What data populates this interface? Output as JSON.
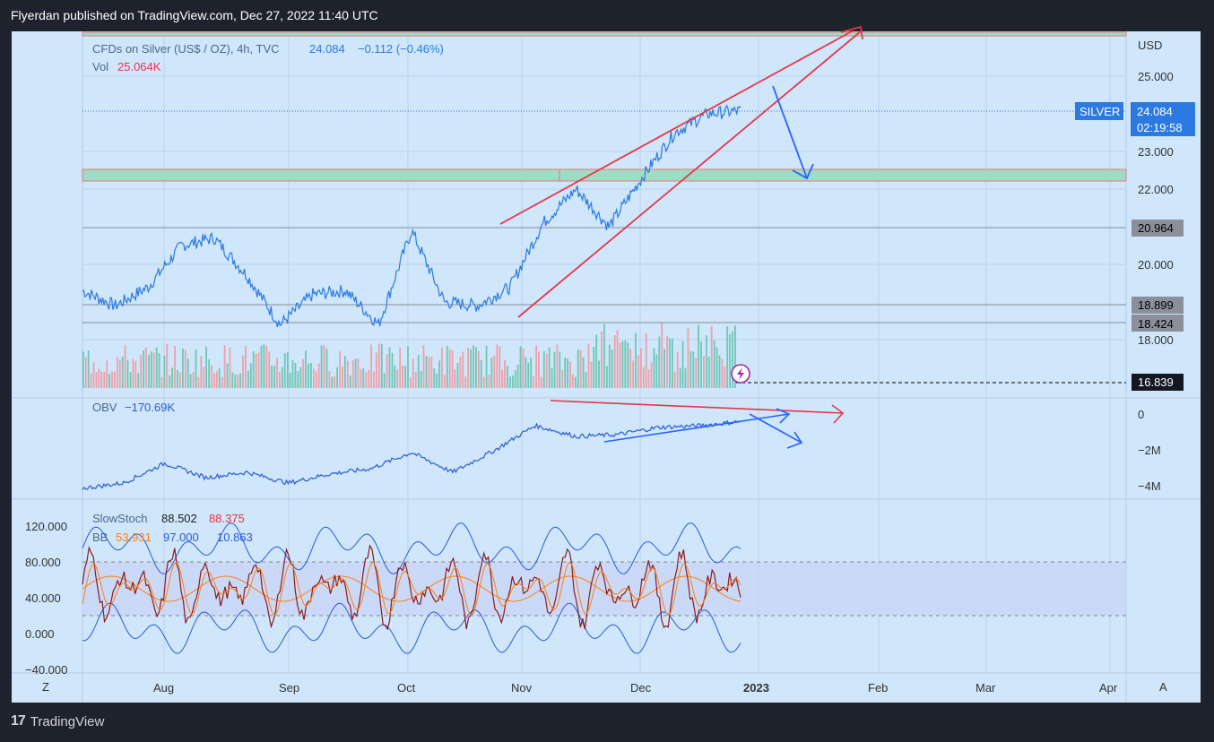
{
  "header": {
    "publisher": "Flyerdan published on TradingView.com, Dec 27, 2022 11:40 UTC"
  },
  "footer": {
    "logo_mark": "17",
    "logo_text": "TradingView"
  },
  "colors": {
    "price_line": "#2a7ae2",
    "up_volume": "#6fc7b4",
    "down_volume": "#f0a0a8",
    "trend_red": "#e8364a",
    "arrow_blue": "#2962ff",
    "stoch_k": "#8b1a1a",
    "stoch_d": "#ff7f0e",
    "bb": "#2a5bd7",
    "zone": "#9fdcc6",
    "band_fill": "#c8d6f7"
  },
  "main_legend": {
    "symbol": "CFDs on Silver (US$ / OZ), 4h, TVC",
    "price": "24.084",
    "change": "−0.112 (−0.46%)",
    "vol_label": "Vol",
    "vol_value": "25.064K"
  },
  "price_axis": {
    "unit": "USD",
    "ticks": [
      "25.000",
      "23.000",
      "22.000",
      "20.000",
      "18.000"
    ],
    "silver_badge": "SILVER",
    "last_price": "24.084",
    "countdown": "02:19:58",
    "level_labels": [
      "20.964",
      "18.899",
      "18.424",
      "16.839"
    ]
  },
  "obv": {
    "label": "OBV",
    "value": "−170.69K",
    "ticks": [
      "0",
      "−2M",
      "−4M"
    ]
  },
  "stoch": {
    "label": "SlowStoch",
    "k": "88.502",
    "d": "88.375",
    "bb_label": "BB",
    "bb_basis": "53.931",
    "bb_upper": "97.000",
    "bb_lower": "10.863",
    "ticks": [
      "120.000",
      "80.000",
      "40.000",
      "0.000",
      "−40.000"
    ]
  },
  "time_axis": {
    "labels": [
      "Aug",
      "Sep",
      "Oct",
      "Nov",
      "Dec",
      "2023",
      "Feb",
      "Mar",
      "Apr"
    ],
    "z_button": "Z",
    "a_button": "A"
  },
  "chart_data": {
    "type": "line",
    "title": "CFDs on Silver (US$ / OZ), 4h, TVC",
    "ylabel": "USD",
    "ylim": [
      16.839,
      25.6
    ],
    "x_range": [
      "Jul",
      "Apr"
    ],
    "x": [
      "Jul",
      "Aug",
      "Aug",
      "Aug",
      "Sep",
      "Sep",
      "Sep",
      "Oct",
      "Oct",
      "Oct",
      "Oct",
      "Nov",
      "Nov",
      "Nov",
      "Nov",
      "Dec",
      "Dec",
      "Dec",
      "Dec"
    ],
    "series": [
      {
        "values": [
          19.3,
          18.9,
          19.4,
          20.5,
          20.7,
          19.7,
          18.4,
          19.2,
          19.3,
          18.4,
          20.9,
          19.0,
          18.9,
          19.4,
          21.1,
          22.0,
          21.0,
          22.3,
          23.5,
          24.0,
          24.08
        ]
      }
    ],
    "horizontal_levels": [
      20.964,
      18.899,
      18.424,
      16.839
    ],
    "zones": [
      [
        22.2,
        22.5
      ]
    ],
    "last_price": 24.084,
    "obv_last": -170690,
    "obv_ylim": [
      -4000000,
      0
    ],
    "stoch_last": {
      "k": 88.502,
      "d": 88.375
    },
    "bb_last": {
      "basis": 53.931,
      "upper": 97.0,
      "lower": 10.863
    },
    "stoch_ylim": [
      -40,
      120
    ],
    "stoch_band": [
      20,
      80
    ],
    "grid": true
  }
}
